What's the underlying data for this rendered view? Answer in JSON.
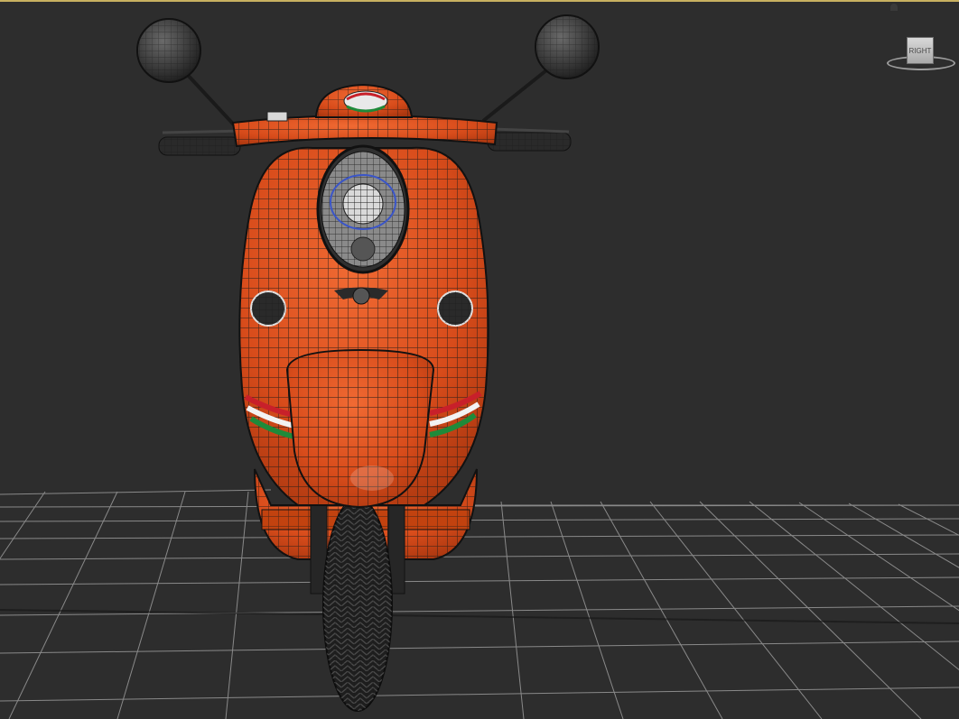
{
  "viewport": {
    "view_label": "Right",
    "accent_color": "#c8b060",
    "background_color": "#2d2d2d"
  },
  "viewcube": {
    "face_label": "RIGHT",
    "icon": "viewcube-icon"
  },
  "model": {
    "subject": "scooter",
    "body_color": "#e2521e",
    "wire_color": "#1b1b1b",
    "stripe_colors": [
      "#c8202a",
      "#f2f2f2",
      "#1f8a3a"
    ]
  }
}
